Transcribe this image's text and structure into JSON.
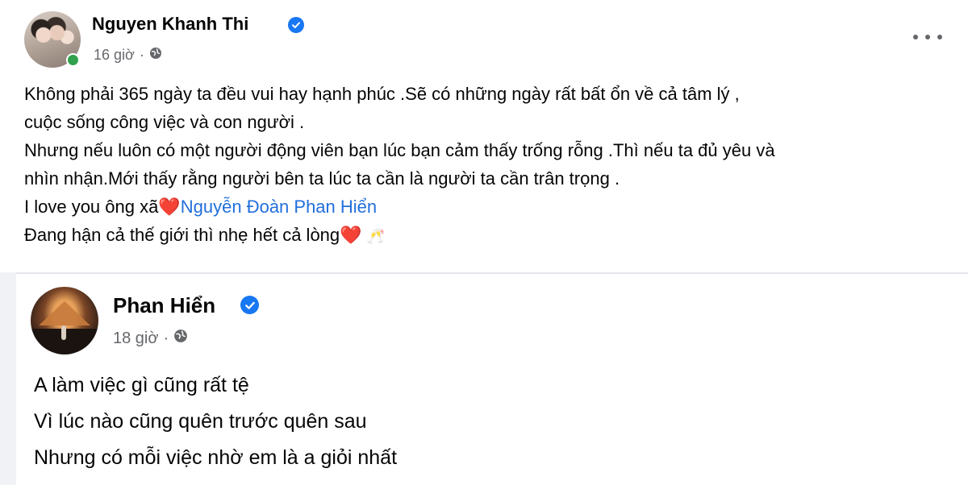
{
  "post1": {
    "author": "Nguyen Khanh Thi",
    "time": "16 giờ",
    "separator": "·",
    "lines": [
      "Không phải 365 ngày ta đều vui hay hạnh phúc .Sẽ có những ngày rất bất ổn về cả tâm lý ,",
      "cuộc sống công việc và con người .",
      "Nhưng nếu luôn có một người động viên bạn lúc bạn cảm thấy trống rỗng .Thì nếu ta đủ yêu và",
      "nhìn nhận.Mới thấy rằng người bên ta lúc ta cần là người ta cần trân trọng ."
    ],
    "love_line_prefix": "I love you ông xã",
    "heart_emoji": "❤️",
    "mention": "Nguyễn Đoàn Phan Hiển",
    "last_line": "Đang hận cả thế giới thì nhẹ hết cả lòng",
    "glasses_emoji": "🥂"
  },
  "post2": {
    "author": "Phan Hiển",
    "time": "18 giờ",
    "separator": "·",
    "lines": [
      "A làm việc gì cũng rất tệ",
      "Vì lúc nào cũng quên trước quên sau",
      "Nhưng có mỗi việc nhờ em là a giỏi nhất"
    ]
  },
  "icons": {
    "verified": "verified-badge-icon",
    "globe": "public-globe-icon",
    "more": "more-options-icon"
  },
  "colors": {
    "link": "#216fdb",
    "verified": "#1877f2",
    "online": "#31a24c",
    "meta": "#65676b"
  }
}
